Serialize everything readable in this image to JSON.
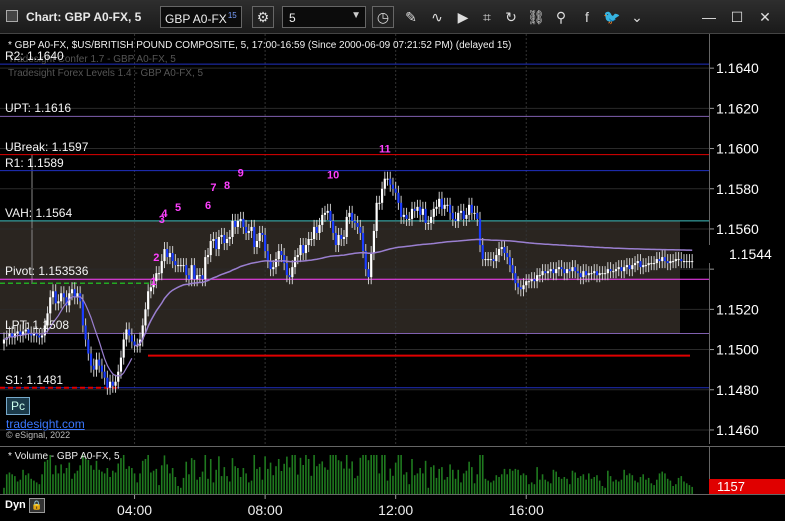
{
  "window": {
    "title": "Chart: GBP A0-FX, 5",
    "symbol": "GBP A0-FX",
    "symbol_sup": "15",
    "interval": "5"
  },
  "legend": {
    "main": "* GBP A0-FX, $US/BRITISH POUND COMPOSITE, 5, 17:00-16:59 (Since 2000-06-09 07:21:52 PM) (delayed 15)",
    "faded_1": "Tradesight Confer 1.7 - GBP A0-FX, 5",
    "faded_2": "Tradesight Forex Levels 1.4 - GBP A0-FX, 5",
    "volume": "* Volume - GBP A0-FX, 5"
  },
  "branding": {
    "pc_button": "Pc",
    "site": "tradesight.com",
    "copyright": "© eSignal, 2022",
    "dyn": "Dyn"
  },
  "colors": {
    "up_candle": "#ffffff",
    "down_candle": "#1a3cff",
    "vwap": "#9a7fd0",
    "level_red": "#e00000",
    "level_purple": "#8060b0",
    "level_cyan": "#40c0c0",
    "level_blue": "#2030c0",
    "value_area": "#2a2520",
    "count_label": "#ff40ff",
    "volume": "#1f7a1f",
    "price_axis_text": "#ffffff"
  },
  "chart_data": {
    "type": "candlestick",
    "price_ticks": [
      1.164,
      1.162,
      1.16,
      1.158,
      1.156,
      1.154,
      1.152,
      1.15,
      1.148,
      1.146
    ],
    "price_tick_labels": [
      "1.1640",
      "1.1620",
      "1.1600",
      "1.1580",
      "1.1560",
      "",
      "1.1520",
      "1.1500",
      "1.1480",
      "1.1460"
    ],
    "ylim": [
      1.1455,
      1.1655
    ],
    "time_labels": [
      "04:00",
      "08:00",
      "12:00",
      "16:00"
    ],
    "time_label_bars": [
      48,
      96,
      144,
      192
    ],
    "bar_count": 250,
    "last_price": "1.1544",
    "last_volume": "1157",
    "levels": [
      {
        "label": "R2: 1.1640",
        "value": 1.1642,
        "color": "#2030c0"
      },
      {
        "label": "UPT: 1.1616",
        "value": 1.1616,
        "color": "#8060b0"
      },
      {
        "label": "UBreak: 1.1597",
        "value": 1.1597,
        "color": "#e00000"
      },
      {
        "label": "R1: 1.1589",
        "value": 1.1589,
        "color": "#2030c0"
      },
      {
        "label": "VAH: 1.1564",
        "value": 1.1564,
        "color": "#40c0c0"
      },
      {
        "label": "Pivot: 1.1535",
        "value": 1.1535,
        "color": "#ff40ff"
      },
      {
        "label": "LPT: 1.1508",
        "value": 1.1508,
        "color": "#8060b0"
      },
      {
        "label": "S1: 1.1481",
        "value": 1.1481,
        "color": "#2030c0"
      }
    ],
    "pivot_suffix": "36",
    "count_labels": [
      {
        "text": "1",
        "bar": 55,
        "value": 1.1532
      },
      {
        "text": "2",
        "bar": 56,
        "value": 1.1544
      },
      {
        "text": "3",
        "bar": 58,
        "value": 1.1563
      },
      {
        "text": "4",
        "bar": 59,
        "value": 1.1566
      },
      {
        "text": "5",
        "bar": 64,
        "value": 1.1569
      },
      {
        "text": "6",
        "bar": 75,
        "value": 1.157
      },
      {
        "text": "7",
        "bar": 77,
        "value": 1.1579
      },
      {
        "text": "8",
        "bar": 82,
        "value": 1.158
      },
      {
        "text": "9",
        "bar": 87,
        "value": 1.1586
      },
      {
        "text": "10",
        "bar": 121,
        "value": 1.1585
      },
      {
        "text": "11",
        "bar": 140,
        "value": 1.1598
      }
    ],
    "closes": [
      1.1505,
      1.1506,
      1.1508,
      1.1506,
      1.1508,
      1.1509,
      1.1507,
      1.1509,
      1.151,
      1.1508,
      1.1507,
      1.1508,
      1.1507,
      1.1506,
      1.1507,
      1.1512,
      1.1518,
      1.1526,
      1.1529,
      1.1523,
      1.1524,
      1.1528,
      1.1526,
      1.1522,
      1.1528,
      1.153,
      1.1526,
      1.1528,
      1.1524,
      1.1512,
      1.1505,
      1.1498,
      1.1492,
      1.149,
      1.1495,
      1.1492,
      1.1489,
      1.1486,
      1.1481,
      1.1484,
      1.1482,
      1.1484,
      1.1489,
      1.1496,
      1.1505,
      1.151,
      1.1507,
      1.1504,
      1.1502,
      1.1502,
      1.1505,
      1.1512,
      1.152,
      1.1529,
      1.1531,
      1.1534,
      1.1538,
      1.1538,
      1.1544,
      1.155,
      1.1546,
      1.1548,
      1.1544,
      1.1542,
      1.1542,
      1.1542,
      1.1542,
      1.1537,
      1.1535,
      1.1542,
      1.1535,
      1.1537,
      1.1537,
      1.1535,
      1.1546,
      1.1547,
      1.1554,
      1.1555,
      1.155,
      1.1556,
      1.1557,
      1.1553,
      1.1555,
      1.1556,
      1.1564,
      1.1561,
      1.1564,
      1.1565,
      1.1561,
      1.1558,
      1.1559,
      1.1561,
      1.1551,
      1.1554,
      1.1558,
      1.1557,
      1.1549,
      1.1544,
      1.154,
      1.1541,
      1.1545,
      1.1549,
      1.1547,
      1.1543,
      1.1537,
      1.1536,
      1.1541,
      1.1546,
      1.1547,
      1.1552,
      1.1548,
      1.1552,
      1.1555,
      1.1555,
      1.1561,
      1.1558,
      1.1562,
      1.1567,
      1.1568,
      1.1569,
      1.1564,
      1.1558,
      1.1552,
      1.1557,
      1.1555,
      1.1556,
      1.1566,
      1.1568,
      1.1564,
      1.1563,
      1.1561,
      1.1558,
      1.1549,
      1.154,
      1.1536,
      1.1548,
      1.1559,
      1.1573,
      1.1573,
      1.158,
      1.1585,
      1.1585,
      1.1582,
      1.158,
      1.1578,
      1.1573,
      1.1566,
      1.1567,
      1.1565,
      1.1565,
      1.157,
      1.1569,
      1.1571,
      1.1567,
      1.157,
      1.1563,
      1.1563,
      1.1566,
      1.157,
      1.1571,
      1.1575,
      1.157,
      1.1572,
      1.1572,
      1.1568,
      1.1565,
      1.1564,
      1.1568,
      1.1569,
      1.1565,
      1.1567,
      1.1572,
      1.1568,
      1.1568,
      1.1565,
      1.1552,
      1.1545,
      1.1545,
      1.1545,
      1.1545,
      1.1544,
      1.1547,
      1.155,
      1.1551,
      1.1548,
      1.1546,
      1.1542,
      1.1538,
      1.1533,
      1.1531,
      1.153,
      1.1532,
      1.1534,
      1.1534,
      1.1535,
      1.1534,
      1.1537,
      1.1537,
      1.1539,
      1.1538,
      1.1539,
      1.154,
      1.1538,
      1.154,
      1.1541,
      1.154,
      1.1538,
      1.154,
      1.1539,
      1.1541,
      1.1539,
      1.1538,
      1.1536,
      1.1539,
      1.1537,
      1.1538,
      1.1538,
      1.1539,
      1.1537,
      1.1538,
      1.1538,
      1.1538,
      1.154,
      1.1539,
      1.1539,
      1.154,
      1.1541,
      1.1539,
      1.1541,
      1.1542,
      1.154,
      1.1542,
      1.1543,
      1.1544,
      1.1541,
      1.1542,
      1.1542,
      1.1543,
      1.1543,
      1.1543,
      1.1545,
      1.1544,
      1.1546,
      1.1544,
      1.1543,
      1.1544,
      1.1544,
      1.1545,
      1.1545,
      1.1544,
      1.1544,
      1.1544,
      1.1544,
      1.1544
    ]
  }
}
